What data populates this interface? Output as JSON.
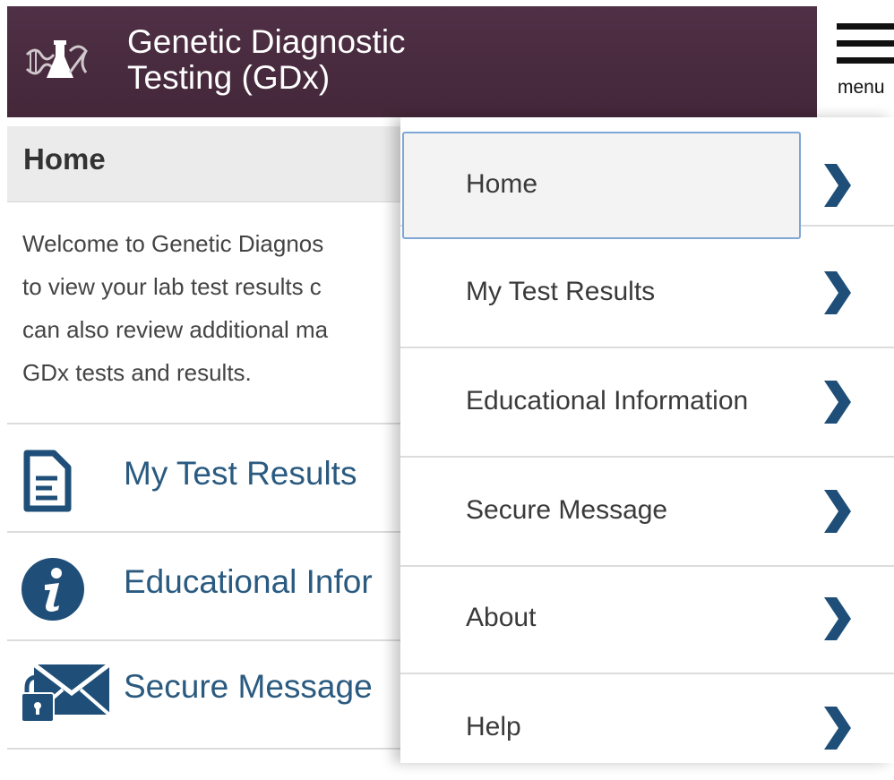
{
  "header": {
    "title_line1": "Genetic Diagnostic",
    "title_line2": "Testing (GDx)",
    "menu_label": "menu"
  },
  "page": {
    "title": "Home",
    "welcome_lines": [
      "Welcome to Genetic Diagnos",
      "to view your lab test results c",
      "can also review additional ma",
      "GDx tests and results."
    ],
    "items": [
      {
        "label": "My Test Results",
        "icon": "document-icon"
      },
      {
        "label": "Educational Infor",
        "icon": "info-icon"
      },
      {
        "label": "Secure Message",
        "icon": "secure-message-icon"
      }
    ]
  },
  "drawer": {
    "items": [
      {
        "label": "Home",
        "active": true
      },
      {
        "label": "My Test Results",
        "active": false
      },
      {
        "label": "Educational Information",
        "active": false
      },
      {
        "label": "Secure Message",
        "active": false
      },
      {
        "label": "About",
        "active": false
      },
      {
        "label": "Help",
        "active": false
      }
    ]
  },
  "colors": {
    "header_bg": "#4a2b40",
    "link_blue": "#2a5a80",
    "chevron_blue": "#1f4f78",
    "active_border": "#7ea6d6"
  }
}
